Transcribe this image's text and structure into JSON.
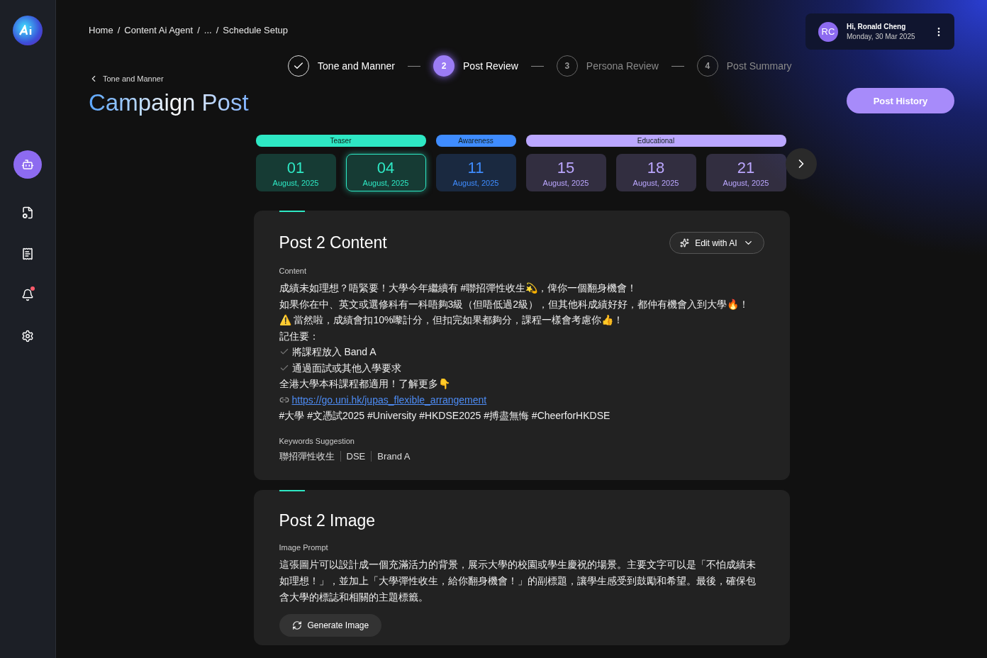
{
  "sidebar": {
    "items": [
      {
        "selected": true
      },
      {
        "selected": false
      },
      {
        "selected": false
      },
      {
        "selected": false,
        "alert": true
      },
      {
        "selected": false
      }
    ]
  },
  "breadcrumb_separator": "/",
  "breadcrumb": [
    "Home",
    "Content Ai  Agent",
    "...",
    "Schedule Setup"
  ],
  "steps": [
    {
      "label": "Tone and Manner",
      "completed": true,
      "selected": false
    },
    {
      "number": "2",
      "label": "Post Review",
      "completed": false,
      "selected": true
    },
    {
      "number": "3",
      "label": "Persona Review",
      "completed": false,
      "selected": false
    },
    {
      "number": "4",
      "label": "Post Summary",
      "completed": false,
      "selected": false
    }
  ],
  "user": {
    "initials": "RC",
    "greeting": "Hi, Ronald Cheng",
    "date": "Monday, 30 Mar 2025"
  },
  "back_link": "Tone and Manner",
  "title": "Campaign Post",
  "post_history_button": "Post History",
  "schedule": [
    {
      "category": "Teaser",
      "color": "#2ee8c4",
      "dates": [
        {
          "day": "01",
          "month": "August, 2025",
          "selected": false
        },
        {
          "day": "04",
          "month": "August, 2025",
          "selected": true
        }
      ]
    },
    {
      "category": "Awareness",
      "color": "#3f8cff",
      "dates": [
        {
          "day": "11",
          "month": "August, 2025",
          "selected": false
        }
      ]
    },
    {
      "category": "Educational",
      "color": "#bba7ff",
      "dates": [
        {
          "day": "15",
          "month": "August, 2025",
          "selected": false
        },
        {
          "day": "18",
          "month": "August, 2025",
          "selected": false
        },
        {
          "day": "21",
          "month": "August, 2025",
          "selected": false
        }
      ]
    }
  ],
  "content_card": {
    "title": "Post 2 Content",
    "edit_button": "Edit with AI",
    "content_label": "Content",
    "lines": [
      {
        "kind": "text",
        "text": "成績未如理想？唔緊要！大學今年繼續有 #聯招彈性收生💫，俾你一個翻身機會！"
      },
      {
        "kind": "text",
        "text": "如果你在中、英文或選修科有一科唔夠3級（但唔低過2級），但其他科成績好好，都仲有機會入到大學🔥！"
      },
      {
        "kind": "text",
        "text": "⚠️ 當然啦，成績會扣10%嚟計分，但扣完如果都夠分，課程一樣會考慮你👍！"
      },
      {
        "kind": "text",
        "text": "記住要："
      },
      {
        "kind": "check",
        "text": "將課程放入 Band A"
      },
      {
        "kind": "check",
        "text": "通過面試或其他入學要求"
      },
      {
        "kind": "text",
        "text": "全港大學本科課程都適用！了解更多👇"
      },
      {
        "kind": "link",
        "text": "https://go.uni.hk/jupas_flexible_arrangement"
      },
      {
        "kind": "text",
        "text": "#大學 #文憑試2025 #University #HKDSE2025 #搏盡無悔 #CheerforHKDSE"
      }
    ],
    "keywords_label": "Keywords Suggestion",
    "keywords": [
      "聯招彈性收生",
      "DSE",
      "Brand A"
    ]
  },
  "image_card": {
    "title": "Post 2 Image",
    "prompt_label": "Image Prompt",
    "prompt": "這張圖片可以設計成一個充滿活力的背景，展示大學的校園或學生慶祝的場景。主要文字可以是「不怕成績未如理想！」，並加上「大學彈性收生，給你翻身機會！」的副標題，讓學生感受到鼓勵和希望。最後，確保包含大學的標誌和相關的主題標籤。",
    "generate_button": "Generate Image"
  }
}
